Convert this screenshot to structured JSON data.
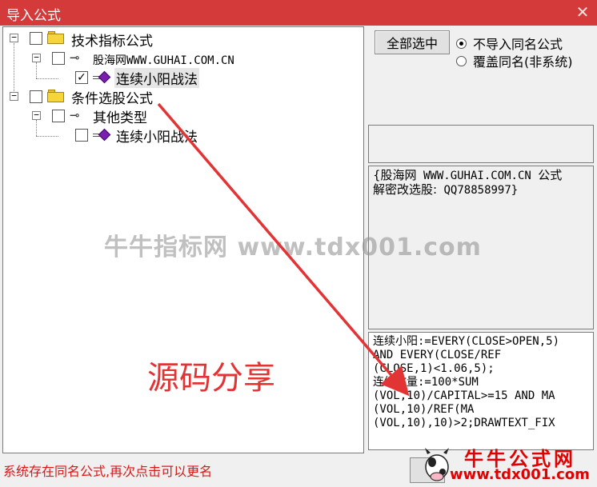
{
  "window": {
    "title": "导入公式",
    "close_glyph": "✕"
  },
  "tree": {
    "nodes": [
      {
        "label": "技术指标公式",
        "checked": false,
        "icon": "folder-icon"
      },
      {
        "label": "股海网WWW.GUHAI.COM.CN",
        "checked": false,
        "icon": "key-icon"
      },
      {
        "label": "连续小阳战法",
        "checked": true,
        "icon": "formula-icon"
      },
      {
        "label": "条件选股公式",
        "checked": false,
        "icon": "folder-icon"
      },
      {
        "label": "其他类型",
        "checked": false,
        "icon": "key-icon"
      },
      {
        "label": "连续小阳战法",
        "checked": false,
        "icon": "formula-icon"
      }
    ],
    "check_glyph": "✓",
    "collapse_glyph": "−",
    "key_glyph": "⊸"
  },
  "options": {
    "select_all_label": "全部选中",
    "radios": [
      {
        "label": "不导入同名公式",
        "selected": true
      },
      {
        "label": "覆盖同名(非系统)",
        "selected": false
      }
    ]
  },
  "description": {
    "line1_cn": "{股海网",
    "line1_rest": " WWW.GUHAI.COM.CN ",
    "line1_cn2": "公式",
    "line2_cn": "解密改选股:",
    "line2_rest": " QQ78858997}"
  },
  "source_code": "连续小阳:=EVERY(CLOSE>OPEN,5)\nAND EVERY(CLOSE/REF\n(CLOSE,1)<1.06,5);\n连续放量:=100*SUM\n(VOL,10)/CAPITAL>=15 AND MA\n(VOL,10)/REF(MA\n(VOL,10),10)>2;DRAWTEXT_FIX",
  "status_message": "系统存在同名公式,再次点击可以更名",
  "watermark": "牛牛指标网 www.tdx001.com",
  "overlay_title": "源码分享",
  "logo": {
    "name": "牛牛公式网",
    "url": "www.tdx001.com"
  },
  "colors": {
    "title_bar": "#d43a3a",
    "accent_red": "#e23434",
    "status_red": "#d81818"
  }
}
